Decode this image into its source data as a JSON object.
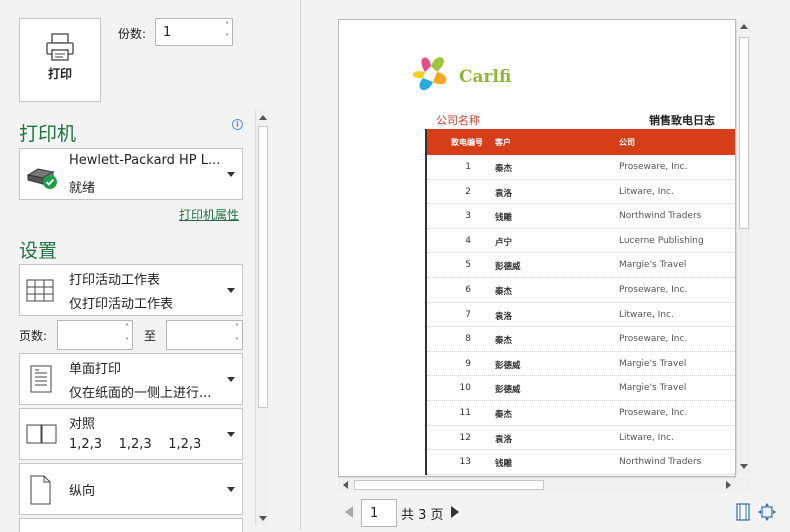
{
  "print": {
    "button_label": "打印"
  },
  "copies": {
    "label": "份数:",
    "value": "1"
  },
  "printer": {
    "section_title": "打印机",
    "name": "Hewlett-Packard HP L...",
    "status": "就绪",
    "properties_link": "打印机属性"
  },
  "settings": {
    "section_title": "设置",
    "scope": {
      "line1": "打印活动工作表",
      "line2": "仅打印活动工作表"
    },
    "pages_label": "页数:",
    "to_label": "至",
    "sides": {
      "line1": "单面打印",
      "line2": "仅在纸面的一侧上进行..."
    },
    "collate": {
      "line1": "对照",
      "line2": "1,2,3    1,2,3    1,2,3"
    },
    "orientation": {
      "line1": "纵向"
    }
  },
  "preview": {
    "logo_text": "Carlfi",
    "company_label": "公司名称",
    "log_title": "销售致电日志",
    "columns": [
      "致电编号",
      "客户",
      "公司"
    ],
    "rows": [
      [
        "1",
        "秦杰",
        "Proseware, Inc."
      ],
      [
        "2",
        "袁洛",
        "Litware, Inc."
      ],
      [
        "3",
        "钱雕",
        "Northwind Traders"
      ],
      [
        "4",
        "卢宁",
        "Lucerne Publishing"
      ],
      [
        "5",
        "彭德威",
        "Margie's Travel"
      ],
      [
        "6",
        "秦杰",
        "Proseware, Inc."
      ],
      [
        "7",
        "袁洛",
        "Litware, Inc."
      ],
      [
        "8",
        "秦杰",
        "Proseware, Inc."
      ],
      [
        "9",
        "彭德威",
        "Margie's Travel"
      ],
      [
        "10",
        "彭德威",
        "Margie's Travel"
      ],
      [
        "11",
        "秦杰",
        "Proseware, Inc."
      ],
      [
        "12",
        "袁洛",
        "Litware, Inc."
      ],
      [
        "13",
        "钱雕",
        "Northwind Traders"
      ]
    ],
    "current_page": "1",
    "total_pages_label": "共 3 页"
  },
  "colors": {
    "accent": "#217346",
    "table_header": "#d63e1a",
    "company_label": "#d2392a"
  }
}
